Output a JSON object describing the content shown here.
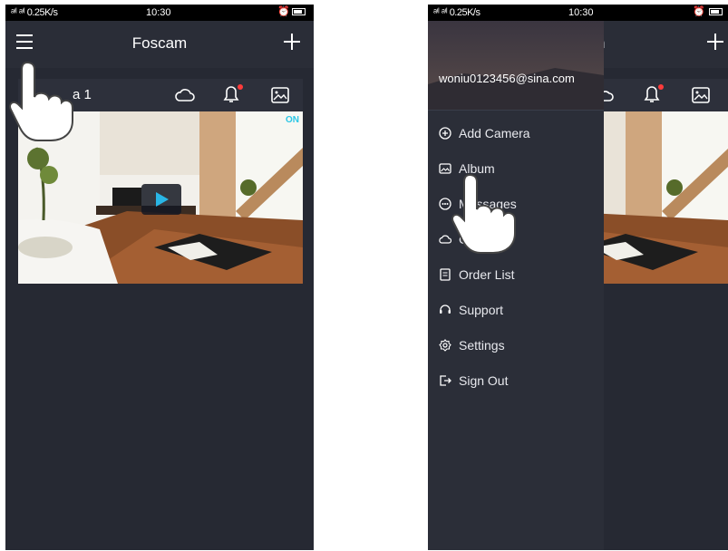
{
  "status_bar": {
    "signal": "ᵃⁱˡ ᵃⁱˡ 0.25K/s",
    "time": "10:30"
  },
  "left_screen": {
    "title": "Foscam",
    "camera_name_visible": "a 1",
    "on_badge": "ON"
  },
  "right_screen": {
    "title_fragment": "n",
    "email": "woniu0123456@sina.com",
    "menu": [
      {
        "label": "Add Camera",
        "icon": "add-circle-icon"
      },
      {
        "label": "Album",
        "icon": "album-icon"
      },
      {
        "label": "Messages",
        "icon": "messages-icon"
      },
      {
        "label": "Cloud",
        "icon": "cloud-icon"
      },
      {
        "label": "Order List",
        "icon": "order-list-icon"
      },
      {
        "label": "Support",
        "icon": "support-icon"
      },
      {
        "label": "Settings",
        "icon": "settings-icon"
      },
      {
        "label": "Sign Out",
        "icon": "sign-out-icon"
      }
    ]
  },
  "colors": {
    "background": "#262933",
    "accent": "#29b6e6",
    "alert": "#ff3b3b"
  }
}
